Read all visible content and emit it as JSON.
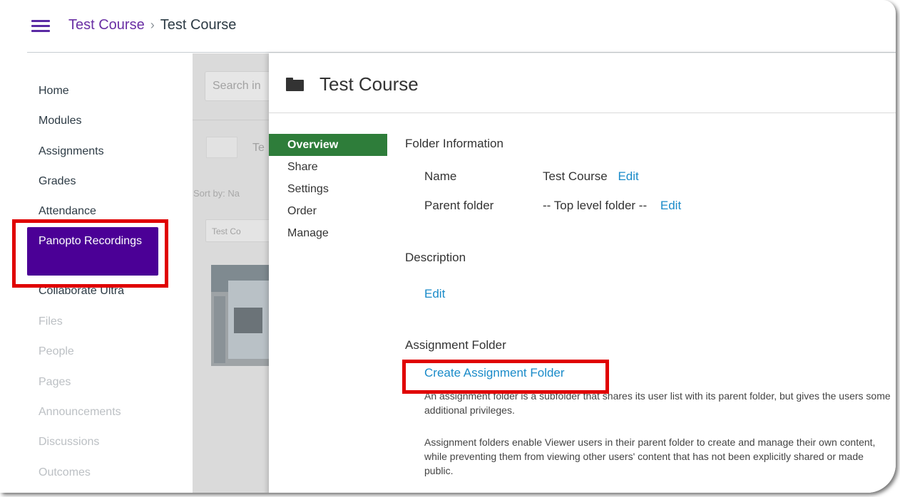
{
  "header": {
    "breadcrumb": [
      "Test Course",
      "Test Course"
    ],
    "separator": "›"
  },
  "course_nav": {
    "items": [
      {
        "label": "Home",
        "state": "normal"
      },
      {
        "label": "Modules",
        "state": "normal"
      },
      {
        "label": "Assignments",
        "state": "normal"
      },
      {
        "label": "Grades",
        "state": "normal"
      },
      {
        "label": "Attendance",
        "state": "normal"
      },
      {
        "label": "Panopto Recordings",
        "state": "active"
      },
      {
        "label": "Collaborate Ultra",
        "state": "normal"
      },
      {
        "label": "Files",
        "state": "disabled"
      },
      {
        "label": "People",
        "state": "disabled"
      },
      {
        "label": "Pages",
        "state": "disabled"
      },
      {
        "label": "Announcements",
        "state": "disabled"
      },
      {
        "label": "Discussions",
        "state": "disabled"
      },
      {
        "label": "Outcomes",
        "state": "disabled"
      }
    ],
    "active_color": "#4b0096"
  },
  "background": {
    "search_placeholder": "Search in",
    "folder_label": "Te",
    "sort_by": "Sort by:  Na",
    "tag_label": "Test Co"
  },
  "pane": {
    "title": "Test Course",
    "tabs": [
      "Overview",
      "Share",
      "Settings",
      "Order",
      "Manage"
    ],
    "active_tab": "Overview",
    "folder_information": {
      "heading": "Folder Information",
      "name_label": "Name",
      "name_value": "Test Course",
      "name_edit": "Edit",
      "parent_label": "Parent folder",
      "parent_value": "-- Top level folder --",
      "parent_edit": "Edit"
    },
    "description": {
      "heading": "Description",
      "edit": "Edit"
    },
    "assignment_folder": {
      "heading": "Assignment Folder",
      "create_link": "Create Assignment Folder",
      "text1": "An assignment folder is a subfolder that shares its user list with its parent folder, but gives the users some additional privileges.",
      "text2": "Assignment folders enable Viewer users in their parent folder to create and manage their own content, while preventing them from viewing other users' content that has not been explicitly shared or made public."
    },
    "accent_green": "#2e7d3a",
    "link_color": "#1a8bc9"
  },
  "highlight_color": "#e00000"
}
